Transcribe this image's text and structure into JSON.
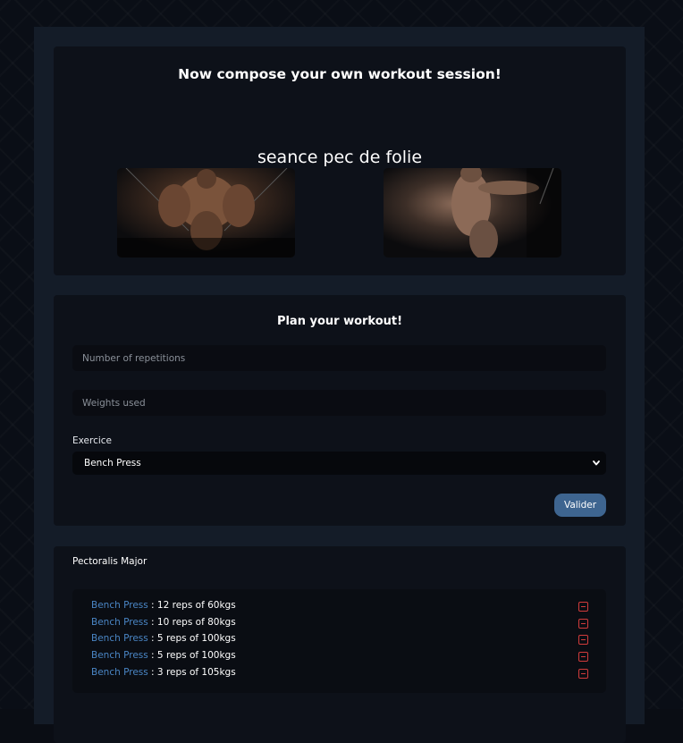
{
  "header": {
    "title": "Now compose your own workout session!",
    "session_name": "seance pec de folie"
  },
  "images": [
    {
      "name": "cable-crossover-photo"
    },
    {
      "name": "cable-pull-photo"
    }
  ],
  "form": {
    "title": "Plan your workout!",
    "reps_placeholder": "Number of repetitions",
    "reps_value": "",
    "weights_placeholder": "Weights used",
    "weights_value": "",
    "exercise_label": "Exercice",
    "exercise_selected": "Bench Press",
    "submit_label": "Valider"
  },
  "session": {
    "muscle_group": "Pectoralis Major",
    "entries": [
      {
        "exercise": "Bench Press",
        "detail": " : 12 reps of 60kgs"
      },
      {
        "exercise": "Bench Press",
        "detail": " : 10 reps of 80kgs"
      },
      {
        "exercise": "Bench Press",
        "detail": " : 5 reps of 100kgs"
      },
      {
        "exercise": "Bench Press",
        "detail": " : 5 reps of 100kgs"
      },
      {
        "exercise": "Bench Press",
        "detail": " : 3 reps of 105kgs"
      }
    ]
  },
  "colors": {
    "accent_button": "#3e6590",
    "link": "#4a86c5",
    "delete": "#d13b3b"
  }
}
